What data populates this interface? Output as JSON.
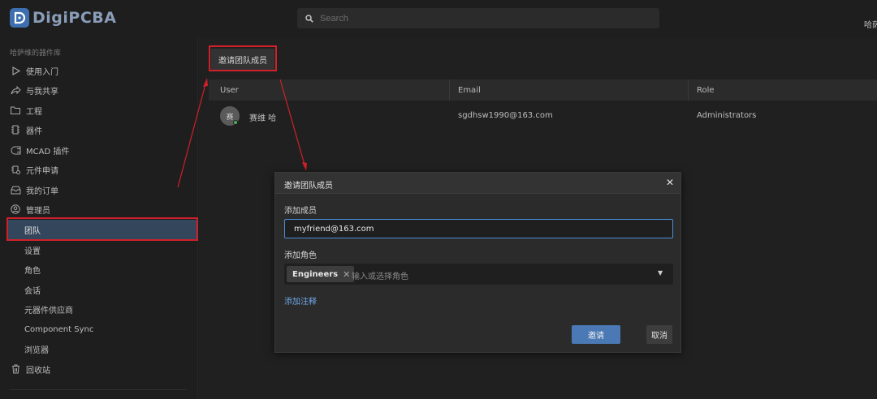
{
  "app": {
    "logo_text": "DigiPCBA",
    "search_placeholder": "Search",
    "user_name": "哈萨"
  },
  "sidebar": {
    "library_title": "哈萨维的器件库",
    "items": [
      {
        "label": "使用入门",
        "icon": "play-icon"
      },
      {
        "label": "与我共享",
        "icon": "share-icon"
      },
      {
        "label": "工程",
        "icon": "folder-icon"
      },
      {
        "label": "器件",
        "icon": "chip-icon"
      },
      {
        "label": "MCAD 插件",
        "icon": "plugin-icon"
      },
      {
        "label": "元件申请",
        "icon": "request-icon"
      },
      {
        "label": "我的订单",
        "icon": "inbox-icon"
      },
      {
        "label": "管理员",
        "icon": "admin-icon"
      }
    ],
    "admin_items": [
      "团队",
      "设置",
      "角色",
      "会话",
      "元器件供应商",
      "Component Sync",
      "浏览器"
    ],
    "active_item": "团队",
    "recycle_label": "回收站"
  },
  "main": {
    "invite_button": "邀请团队成员",
    "columns": [
      "User",
      "Email",
      "Role"
    ],
    "rows": [
      {
        "avatar": "赛",
        "user": "赛维 哈",
        "email": "sgdhsw1990@163.com",
        "role": "Administrators",
        "status_color": "#4fae5a"
      }
    ]
  },
  "modal": {
    "title": "邀请团队成员",
    "close_icon": "close-icon",
    "add_member_label": "添加成员",
    "member_value": "myfriend@163.com",
    "add_role_label": "添加角色",
    "selected_role": "Engineers",
    "role_placeholder": "输入或选择角色",
    "add_note": "添加注释",
    "invite_button": "邀请",
    "cancel_button": "取消"
  },
  "colors": {
    "accent": "#4a79b5",
    "active_nav": "#34465c",
    "annotation": "#d0202a",
    "link": "#6ea7e6"
  }
}
